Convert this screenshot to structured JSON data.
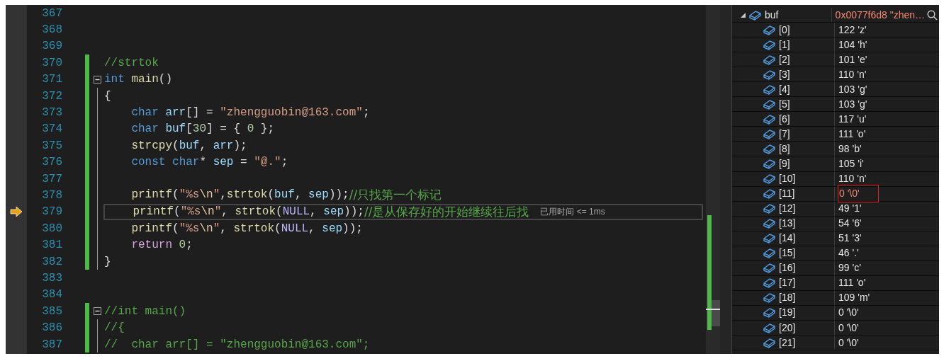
{
  "editor": {
    "lines": [
      {
        "number": "367",
        "changed": false,
        "collapsible": false,
        "guide": false,
        "current": false
      },
      {
        "number": "368",
        "changed": false,
        "collapsible": false,
        "guide": false,
        "current": false
      },
      {
        "number": "369",
        "changed": false,
        "collapsible": false,
        "guide": false,
        "current": false
      },
      {
        "number": "370",
        "changed": true,
        "collapsible": false,
        "guide": false,
        "current": false,
        "tokens": [
          {
            "kind": "comment",
            "text": "//strtok"
          }
        ]
      },
      {
        "number": "371",
        "changed": true,
        "collapsible": true,
        "guide": false,
        "current": false,
        "tokens": [
          {
            "kind": "keyword",
            "text": "int"
          },
          {
            "kind": "func",
            "text": " main"
          },
          {
            "kind": "plain",
            "text": "()"
          }
        ]
      },
      {
        "number": "372",
        "changed": true,
        "collapsible": false,
        "guide": true,
        "current": false,
        "tokens": [
          {
            "kind": "plain",
            "text": "{"
          }
        ]
      },
      {
        "number": "373",
        "changed": true,
        "collapsible": false,
        "guide": true,
        "current": false,
        "tokens": [
          {
            "kind": "keyword",
            "text": "    char"
          },
          {
            "kind": "var",
            "text": " arr"
          },
          {
            "kind": "plain",
            "text": "[] = "
          },
          {
            "kind": "string",
            "text": "\"zhengguobin@163.com\""
          },
          {
            "kind": "plain",
            "text": ";"
          }
        ]
      },
      {
        "number": "374",
        "changed": true,
        "collapsible": false,
        "guide": true,
        "current": false,
        "tokens": [
          {
            "kind": "keyword",
            "text": "    char"
          },
          {
            "kind": "var",
            "text": " buf"
          },
          {
            "kind": "plain",
            "text": "["
          },
          {
            "kind": "number",
            "text": "30"
          },
          {
            "kind": "plain",
            "text": "] = { "
          },
          {
            "kind": "number",
            "text": "0"
          },
          {
            "kind": "plain",
            "text": " };"
          }
        ]
      },
      {
        "number": "375",
        "changed": true,
        "collapsible": false,
        "guide": true,
        "current": false,
        "tokens": [
          {
            "kind": "func",
            "text": "    strcpy"
          },
          {
            "kind": "plain",
            "text": "("
          },
          {
            "kind": "var",
            "text": "buf"
          },
          {
            "kind": "plain",
            "text": ", "
          },
          {
            "kind": "var",
            "text": "arr"
          },
          {
            "kind": "plain",
            "text": ");"
          }
        ]
      },
      {
        "number": "376",
        "changed": true,
        "collapsible": false,
        "guide": true,
        "current": false,
        "tokens": [
          {
            "kind": "keyword",
            "text": "    const"
          },
          {
            "kind": "keyword",
            "text": " char"
          },
          {
            "kind": "plain",
            "text": "* "
          },
          {
            "kind": "var",
            "text": "sep"
          },
          {
            "kind": "plain",
            "text": " = "
          },
          {
            "kind": "string",
            "text": "\"@.\""
          },
          {
            "kind": "plain",
            "text": ";"
          }
        ]
      },
      {
        "number": "377",
        "changed": true,
        "collapsible": false,
        "guide": true,
        "current": false
      },
      {
        "number": "378",
        "changed": true,
        "collapsible": false,
        "guide": true,
        "current": false,
        "tokens": [
          {
            "kind": "func",
            "text": "    printf"
          },
          {
            "kind": "plain",
            "text": "("
          },
          {
            "kind": "string",
            "text": "\"%s"
          },
          {
            "kind": "escape",
            "text": "\\n"
          },
          {
            "kind": "string",
            "text": "\""
          },
          {
            "kind": "plain",
            "text": ","
          },
          {
            "kind": "func",
            "text": "strtok"
          },
          {
            "kind": "plain",
            "text": "("
          },
          {
            "kind": "var",
            "text": "buf"
          },
          {
            "kind": "plain",
            "text": ", "
          },
          {
            "kind": "var",
            "text": "sep"
          },
          {
            "kind": "plain",
            "text": "));"
          },
          {
            "kind": "comment",
            "text": "//只找第一个标记"
          }
        ]
      },
      {
        "number": "379",
        "changed": true,
        "collapsible": false,
        "guide": true,
        "current": true,
        "elapsed": "已用时间 <= 1ms",
        "tokens": [
          {
            "kind": "func",
            "text": "    printf"
          },
          {
            "kind": "plain",
            "text": "("
          },
          {
            "kind": "string",
            "text": "\"%s"
          },
          {
            "kind": "escape",
            "text": "\\n"
          },
          {
            "kind": "string",
            "text": "\""
          },
          {
            "kind": "plain",
            "text": ", "
          },
          {
            "kind": "func",
            "text": "strtok"
          },
          {
            "kind": "plain",
            "text": "("
          },
          {
            "kind": "macro",
            "text": "NULL"
          },
          {
            "kind": "plain",
            "text": ", "
          },
          {
            "kind": "var",
            "text": "sep"
          },
          {
            "kind": "plain",
            "text": "));"
          },
          {
            "kind": "comment",
            "text": "//是从保存好的开始继续往后找"
          }
        ]
      },
      {
        "number": "380",
        "changed": true,
        "collapsible": false,
        "guide": true,
        "current": false,
        "tokens": [
          {
            "kind": "func",
            "text": "    printf"
          },
          {
            "kind": "plain",
            "text": "("
          },
          {
            "kind": "string",
            "text": "\"%s"
          },
          {
            "kind": "escape",
            "text": "\\n"
          },
          {
            "kind": "string",
            "text": "\""
          },
          {
            "kind": "plain",
            "text": ", "
          },
          {
            "kind": "func",
            "text": "strtok"
          },
          {
            "kind": "plain",
            "text": "("
          },
          {
            "kind": "macro",
            "text": "NULL"
          },
          {
            "kind": "plain",
            "text": ", "
          },
          {
            "kind": "var",
            "text": "sep"
          },
          {
            "kind": "plain",
            "text": "));"
          }
        ]
      },
      {
        "number": "381",
        "changed": true,
        "collapsible": false,
        "guide": true,
        "current": false,
        "tokens": [
          {
            "kind": "control",
            "text": "    return"
          },
          {
            "kind": "number",
            "text": " 0"
          },
          {
            "kind": "plain",
            "text": ";"
          }
        ]
      },
      {
        "number": "382",
        "changed": true,
        "collapsible": false,
        "guide": true,
        "current": false,
        "tokens": [
          {
            "kind": "plain",
            "text": "}"
          }
        ]
      },
      {
        "number": "383",
        "changed": false,
        "collapsible": false,
        "guide": false,
        "current": false
      },
      {
        "number": "384",
        "changed": false,
        "collapsible": false,
        "guide": false,
        "current": false
      },
      {
        "number": "385",
        "changed": true,
        "collapsible": true,
        "guide": false,
        "current": false,
        "tokens": [
          {
            "kind": "comment",
            "text": "//int main()"
          }
        ]
      },
      {
        "number": "386",
        "changed": true,
        "collapsible": false,
        "guide": true,
        "current": false,
        "tokens": [
          {
            "kind": "comment",
            "text": "//{"
          }
        ]
      },
      {
        "number": "387",
        "changed": true,
        "collapsible": false,
        "guide": true,
        "current": false,
        "tokens": [
          {
            "kind": "comment",
            "text": "//  char arr[] = \"zhengguobin@163.com\";"
          }
        ]
      }
    ]
  },
  "watch": {
    "name": "buf",
    "expanded": true,
    "value": "0x0077f6d8 \"zhen…",
    "changed": true,
    "children": [
      {
        "name": "[0]",
        "value": "122 'z'",
        "changed": false,
        "outlined": false
      },
      {
        "name": "[1]",
        "value": "104 'h'",
        "changed": false,
        "outlined": false
      },
      {
        "name": "[2]",
        "value": "101 'e'",
        "changed": false,
        "outlined": false
      },
      {
        "name": "[3]",
        "value": "110 'n'",
        "changed": false,
        "outlined": false
      },
      {
        "name": "[4]",
        "value": "103 'g'",
        "changed": false,
        "outlined": false
      },
      {
        "name": "[5]",
        "value": "103 'g'",
        "changed": false,
        "outlined": false
      },
      {
        "name": "[6]",
        "value": "117 'u'",
        "changed": false,
        "outlined": false
      },
      {
        "name": "[7]",
        "value": "111 'o'",
        "changed": false,
        "outlined": false
      },
      {
        "name": "[8]",
        "value": "98 'b'",
        "changed": false,
        "outlined": false
      },
      {
        "name": "[9]",
        "value": "105 'i'",
        "changed": false,
        "outlined": false
      },
      {
        "name": "[10]",
        "value": "110 'n'",
        "changed": false,
        "outlined": false
      },
      {
        "name": "[11]",
        "value": "0 '\\0'",
        "changed": true,
        "outlined": true
      },
      {
        "name": "[12]",
        "value": "49 '1'",
        "changed": false,
        "outlined": false
      },
      {
        "name": "[13]",
        "value": "54 '6'",
        "changed": false,
        "outlined": false
      },
      {
        "name": "[14]",
        "value": "51 '3'",
        "changed": false,
        "outlined": false
      },
      {
        "name": "[15]",
        "value": "46 '.'",
        "changed": false,
        "outlined": false
      },
      {
        "name": "[16]",
        "value": "99 'c'",
        "changed": false,
        "outlined": false
      },
      {
        "name": "[17]",
        "value": "111 'o'",
        "changed": false,
        "outlined": false
      },
      {
        "name": "[18]",
        "value": "109 'm'",
        "changed": false,
        "outlined": false
      },
      {
        "name": "[19]",
        "value": "0 '\\0'",
        "changed": false,
        "outlined": false
      },
      {
        "name": "[20]",
        "value": "0 '\\0'",
        "changed": false,
        "outlined": false
      },
      {
        "name": "[21]",
        "value": "0 '\\0'",
        "changed": false,
        "outlined": false
      }
    ]
  }
}
